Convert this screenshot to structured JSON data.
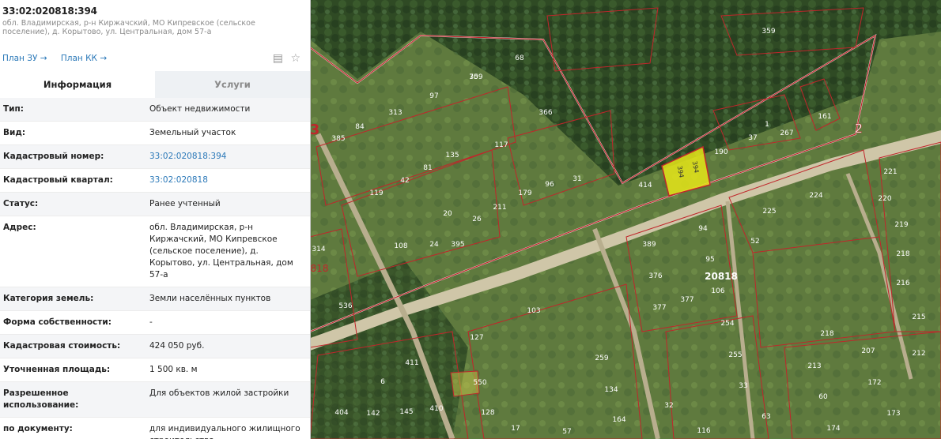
{
  "header": {
    "cadastral_number": "33:02:020818:394",
    "address_short": "обл. Владимирская, р-н Киржачский, МО Кипревское (сельское поселение), д. Корытово, ул. Центральная, дом 57-а"
  },
  "links": {
    "plan_zu": "План ЗУ →",
    "plan_kk": "План КК →"
  },
  "tabs": {
    "info": "Информация",
    "services": "Услуги"
  },
  "info_rows": [
    {
      "key": "Тип:",
      "value": "Объект недвижимости",
      "link": false
    },
    {
      "key": "Вид:",
      "value": "Земельный участок",
      "link": false
    },
    {
      "key": "Кадастровый номер:",
      "value": "33:02:020818:394",
      "link": true
    },
    {
      "key": "Кадастровый квартал:",
      "value": "33:02:020818",
      "link": true
    },
    {
      "key": "Статус:",
      "value": "Ранее учтенный",
      "link": false
    },
    {
      "key": "Адрес:",
      "value": "обл. Владимирская, р-н Киржачский, МО Кипревское (сельское поселение), д. Корытово, ул. Центральная, дом 57-а",
      "link": false
    },
    {
      "key": "Категория земель:",
      "value": "Земли населённых пунктов",
      "link": false
    },
    {
      "key": "Форма собственности:",
      "value": "-",
      "link": false
    },
    {
      "key": "Кадастровая стоимость:",
      "value": "424 050 руб.",
      "link": false
    },
    {
      "key": "Уточненная площадь:",
      "value": "1 500 кв. м",
      "link": false
    },
    {
      "key": "Разрешенное использование:",
      "value": "Для объектов жилой застройки",
      "link": false
    },
    {
      "key": "по документу:",
      "value": "для индивидуального жилищного строительства",
      "link": false
    }
  ],
  "map": {
    "quarter_label": "20818",
    "selected_parcel": "394",
    "edge_labels": [
      "3",
      "2",
      "818"
    ],
    "parcel_labels": [
      {
        "t": "359"
      },
      {
        "t": "359"
      },
      {
        "t": "68"
      },
      {
        "t": "70"
      },
      {
        "t": "97"
      },
      {
        "t": "313"
      },
      {
        "t": "366"
      },
      {
        "t": "84"
      },
      {
        "t": "385"
      },
      {
        "t": "117"
      },
      {
        "t": "135"
      },
      {
        "t": "81"
      },
      {
        "t": "42"
      },
      {
        "t": "119"
      },
      {
        "t": "179"
      },
      {
        "t": "96"
      },
      {
        "t": "31"
      },
      {
        "t": "211"
      },
      {
        "t": "20"
      },
      {
        "t": "26"
      },
      {
        "t": "108"
      },
      {
        "t": "24"
      },
      {
        "t": "395"
      },
      {
        "t": "414"
      },
      {
        "t": "190"
      },
      {
        "t": "37"
      },
      {
        "t": "1"
      },
      {
        "t": "267"
      },
      {
        "t": "161"
      },
      {
        "t": "221"
      },
      {
        "t": "224"
      },
      {
        "t": "220"
      },
      {
        "t": "225"
      },
      {
        "t": "219"
      },
      {
        "t": "52"
      },
      {
        "t": "218"
      },
      {
        "t": "94"
      },
      {
        "t": "389"
      },
      {
        "t": "95"
      },
      {
        "t": "376"
      },
      {
        "t": "106"
      },
      {
        "t": "377"
      },
      {
        "t": "377"
      },
      {
        "t": "254"
      },
      {
        "t": "216"
      },
      {
        "t": "215"
      },
      {
        "t": "314"
      },
      {
        "t": "536"
      },
      {
        "t": "103"
      },
      {
        "t": "127"
      },
      {
        "t": "259"
      },
      {
        "t": "255"
      },
      {
        "t": "218"
      },
      {
        "t": "207"
      },
      {
        "t": "212"
      },
      {
        "t": "411"
      },
      {
        "t": "6"
      },
      {
        "t": "550"
      },
      {
        "t": "134"
      },
      {
        "t": "213"
      },
      {
        "t": "172"
      },
      {
        "t": "33"
      },
      {
        "t": "404"
      },
      {
        "t": "142"
      },
      {
        "t": "145"
      },
      {
        "t": "410"
      },
      {
        "t": "128"
      },
      {
        "t": "164"
      },
      {
        "t": "63"
      },
      {
        "t": "60"
      },
      {
        "t": "173"
      },
      {
        "t": "174"
      },
      {
        "t": "57"
      },
      {
        "t": "116"
      },
      {
        "t": "32"
      },
      {
        "t": "17"
      }
    ]
  }
}
